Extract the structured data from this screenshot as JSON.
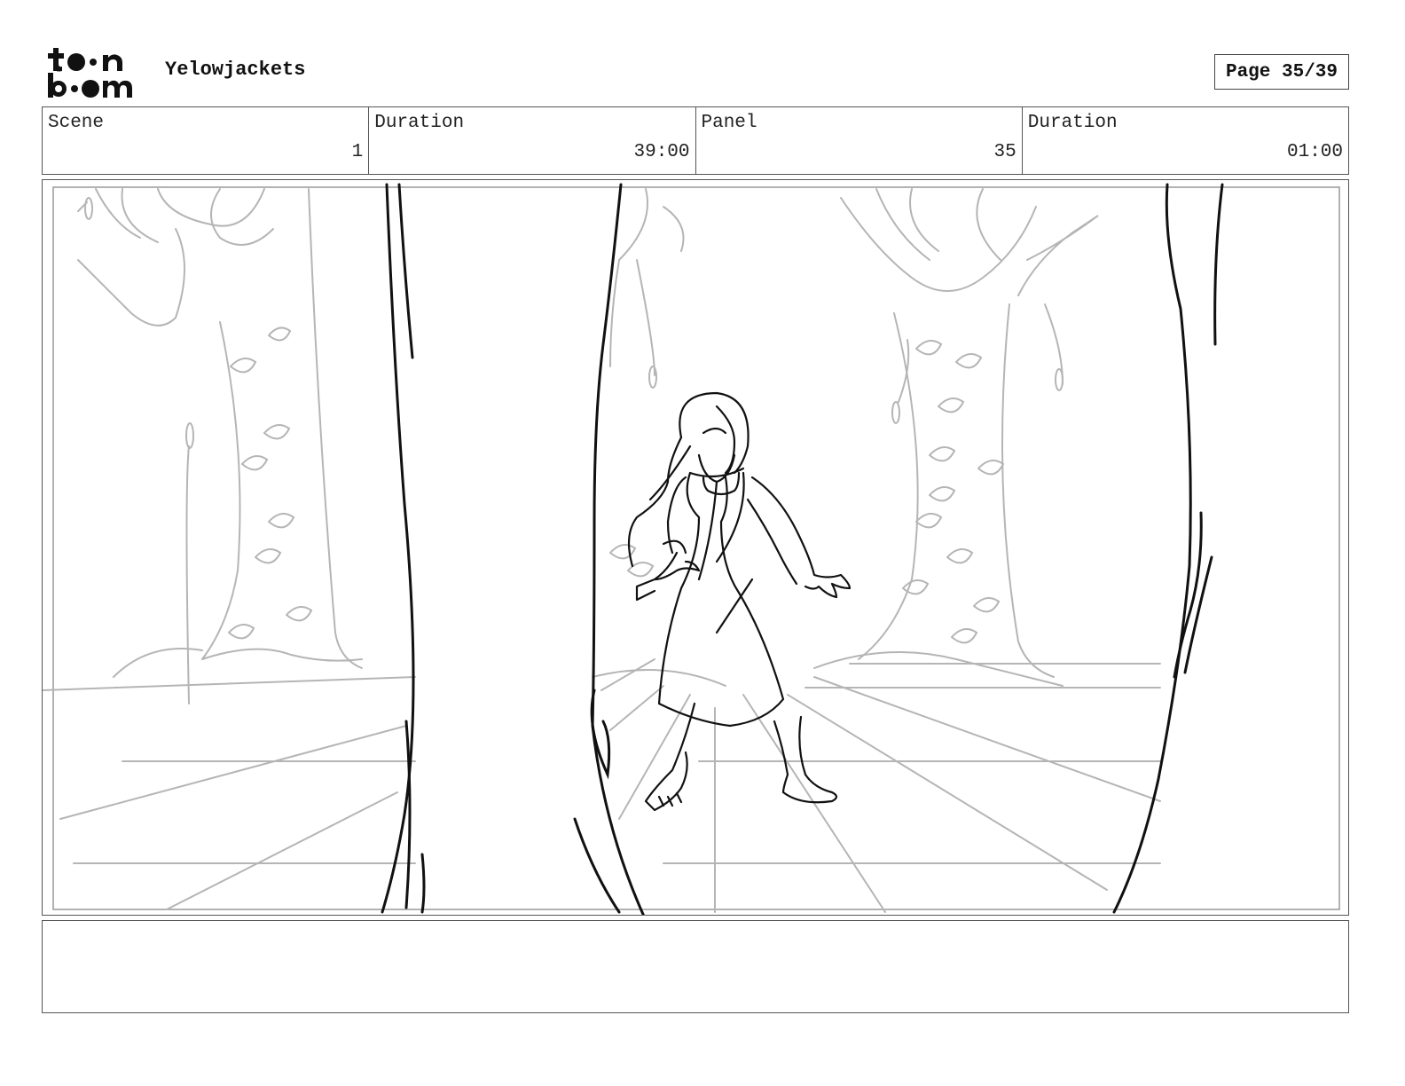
{
  "header": {
    "project_title": "Yelowjackets",
    "page_label": "Page",
    "page_number": "35/39"
  },
  "info": {
    "scene_label": "Scene",
    "scene_value": "1",
    "scene_duration_label": "Duration",
    "scene_duration_value": "39:00",
    "panel_label": "Panel",
    "panel_value": "35",
    "panel_duration_label": "Duration",
    "panel_duration_value": "01:00"
  },
  "notes": {
    "text": ""
  },
  "colors": {
    "sketch_dark": "#111111",
    "sketch_light": "#b5b5b5",
    "border": "#555555"
  }
}
